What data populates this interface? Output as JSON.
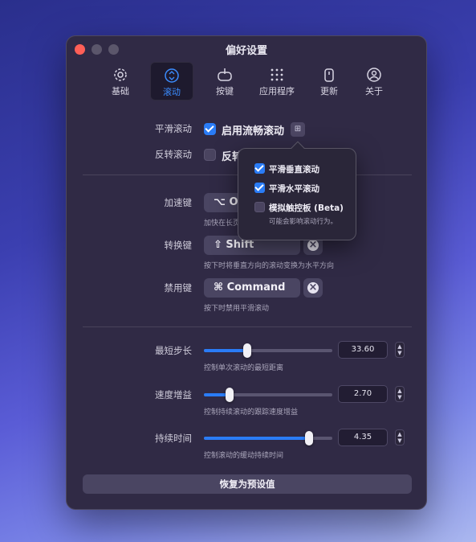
{
  "window": {
    "title": "偏好设置"
  },
  "tabs": [
    {
      "label": "基础",
      "icon": "gear-icon"
    },
    {
      "label": "滚动",
      "icon": "scroll-icon",
      "active": true
    },
    {
      "label": "按键",
      "icon": "mouse-icon"
    },
    {
      "label": "应用程序",
      "icon": "apps-grid-icon"
    },
    {
      "label": "更新",
      "icon": "update-icon"
    },
    {
      "label": "关于",
      "icon": "person-circle-icon"
    }
  ],
  "smooth_scroll": {
    "label": "平滑滚动",
    "checkbox_label": "启用流畅滚动",
    "checked": true
  },
  "reverse_scroll": {
    "label": "反转滚动",
    "checkbox_label": "反转",
    "checked": false
  },
  "popover": {
    "items": [
      {
        "label": "平滑垂直滚动",
        "checked": true
      },
      {
        "label": "平滑水平滚动",
        "checked": true
      },
      {
        "label": "模拟触控板 (Beta)",
        "checked": false
      }
    ],
    "note": "可能会影响滚动行为。"
  },
  "keys": [
    {
      "label": "加速键",
      "value": "⌥ Op",
      "hint": "加快在长页"
    },
    {
      "label": "转换键",
      "value": "⇧ Shift",
      "hint": "按下时将垂直方向的滚动变换为水平方向"
    },
    {
      "label": "禁用键",
      "value": "⌘ Command",
      "hint": "按下时禁用平滑滚动"
    }
  ],
  "sliders": [
    {
      "label": "最短步长",
      "value_text": "33.60",
      "fraction": 0.34,
      "hint": "控制单次滚动的最短距离"
    },
    {
      "label": "速度增益",
      "value_text": "2.70",
      "fraction": 0.2,
      "hint": "控制持续滚动的跟踪速度增益"
    },
    {
      "label": "持续时间",
      "value_text": "4.35",
      "fraction": 0.82,
      "hint": "控制滚动的缓动持续时间"
    }
  ],
  "reset_button": "恢复为预设值",
  "colors": {
    "accent": "#2a7cf6",
    "close": "#ff5f57",
    "window_bg": "#302a45"
  }
}
